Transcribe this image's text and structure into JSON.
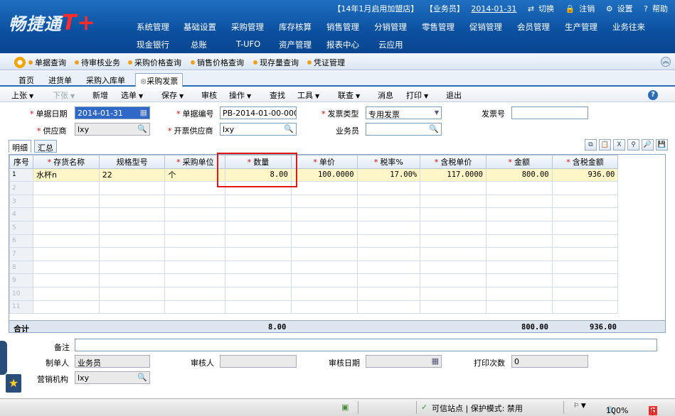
{
  "app": {
    "logo_text": "畅捷通",
    "logo_plus": "T+"
  },
  "top_info": {
    "store": "【14年1月启用加盟店】",
    "user": "【业务员】",
    "date": "2014-01-31",
    "switch": "切换",
    "logout": "注销",
    "settings": "设置",
    "help": "帮助"
  },
  "menu_row1": [
    "系统管理",
    "基础设置",
    "采购管理",
    "库存核算",
    "销售管理",
    "分销管理",
    "零售管理",
    "促销管理",
    "会员管理",
    "生产管理",
    "业务往来"
  ],
  "menu_row2": [
    "现金银行",
    "总账",
    "T-UFO",
    "资产管理",
    "报表中心",
    "云应用"
  ],
  "quick_links": [
    "单据查询",
    "待审核业务",
    "采购价格查询",
    "销售价格查询",
    "现存量查询",
    "凭证管理"
  ],
  "tabs": [
    "首页",
    "进货单",
    "采购入库单",
    "采购发票"
  ],
  "toolbar": {
    "items": [
      "上张",
      "下张",
      "新增",
      "选单",
      "保存",
      "审核",
      "操作",
      "查找",
      "工具",
      "联查",
      "消息",
      "打印",
      "退出"
    ]
  },
  "form": {
    "doc_date_label": "单据日期",
    "doc_date": "2014-01-31",
    "doc_no_label": "单据编号",
    "doc_no": "PB-2014-01-00-0003",
    "invoice_type_label": "发票类型",
    "invoice_type": "专用发票",
    "invoice_no_label": "发票号",
    "invoice_no": "",
    "supplier_label": "供应商",
    "supplier": "lxy",
    "invoice_supplier_label": "开票供应商",
    "invoice_supplier": "lxy",
    "salesman_label": "业务员",
    "salesman": ""
  },
  "section_tabs": [
    "明细",
    "汇总"
  ],
  "grid": {
    "columns": [
      "序号",
      "存货名称",
      "规格型号",
      "采购单位",
      "数量",
      "单价",
      "税率%",
      "含税单价",
      "金额",
      "含税金额"
    ],
    "required": [
      false,
      true,
      false,
      true,
      true,
      true,
      true,
      true,
      true,
      true
    ],
    "rows": [
      [
        "1",
        "水杯n",
        "22",
        "个",
        "8.00",
        "100.0000",
        "17.00%",
        "117.0000",
        "800.00",
        "936.00"
      ]
    ],
    "empty_rows": [
      "2",
      "3",
      "4",
      "5",
      "6",
      "7",
      "8",
      "9",
      "10",
      "11"
    ],
    "total_label": "合计",
    "total_qty": "8.00",
    "total_amount": "800.00",
    "total_tax_amount": "936.00"
  },
  "bottom": {
    "remark_label": "备注",
    "remark": "",
    "creator_label": "制单人",
    "creator": "业务员",
    "auditor_label": "审核人",
    "auditor": "",
    "audit_date_label": "审核日期",
    "audit_date": "",
    "print_count_label": "打印次数",
    "print_count": "0",
    "org_label": "营销机构",
    "org": "lxy"
  },
  "status": {
    "trusted": "可信站点 | 保护模式: 禁用",
    "zoom": "100%",
    "ime": "中"
  }
}
